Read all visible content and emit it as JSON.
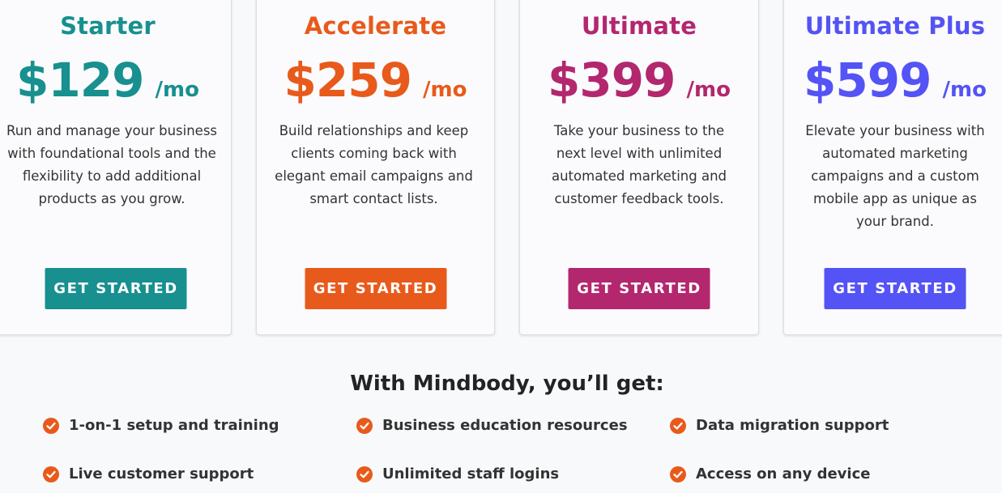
{
  "plans": [
    {
      "name": "Starter",
      "price": "$129",
      "per": "/mo",
      "description": "Run and manage your business with foundational tools and the flexibility to add additional products as you grow.",
      "cta": "GET STARTED",
      "accent": "#17908f",
      "button_color": "#17908f"
    },
    {
      "name": "Accelerate",
      "price": "$259",
      "per": "/mo",
      "description": "Build relationships and keep clients coming back with elegant email campaigns and smart contact lists.",
      "cta": "GET STARTED",
      "accent": "#e85a1b",
      "button_color": "#e85a1b"
    },
    {
      "name": "Ultimate",
      "price": "$399",
      "per": "/mo",
      "description": "Take your business to the next level with unlimited automated marketing and customer feedback tools.",
      "cta": "GET STARTED",
      "accent": "#b3276e",
      "button_color": "#b3276e"
    },
    {
      "name": "Ultimate Plus",
      "price": "$599",
      "per": "/mo",
      "description": "Elevate your business with automated marketing campaigns and a custom mobile app as unique as your brand.",
      "cta": "GET STARTED",
      "accent": "#5453f5",
      "button_color": "#5453f5"
    }
  ],
  "benefits": {
    "title": "With Mindbody, you’ll get:",
    "check_color": "#e85a1b",
    "items": [
      "1-on-1 setup and training",
      "Business education resources",
      "Data migration support",
      "Live customer support",
      "Unlimited staff logins",
      "Access on any device"
    ]
  }
}
